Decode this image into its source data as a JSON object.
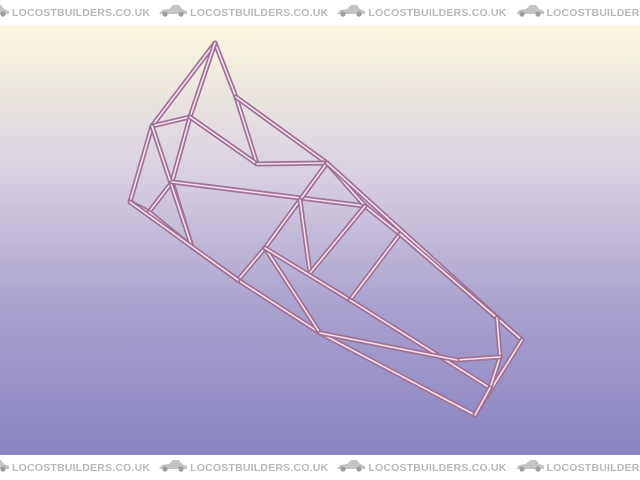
{
  "watermark": {
    "text": "LOCOSTBUILDERS.CO.UK",
    "logo_icon": "car-logo-icon",
    "color": "#b8b8b8"
  },
  "viewport": {
    "subject": "chassis-frame",
    "tube_color": "#a07296",
    "tube_highlight": "#f3e3ef",
    "gradient_top": "#fbf8de",
    "gradient_bottom": "#8a84c1"
  }
}
